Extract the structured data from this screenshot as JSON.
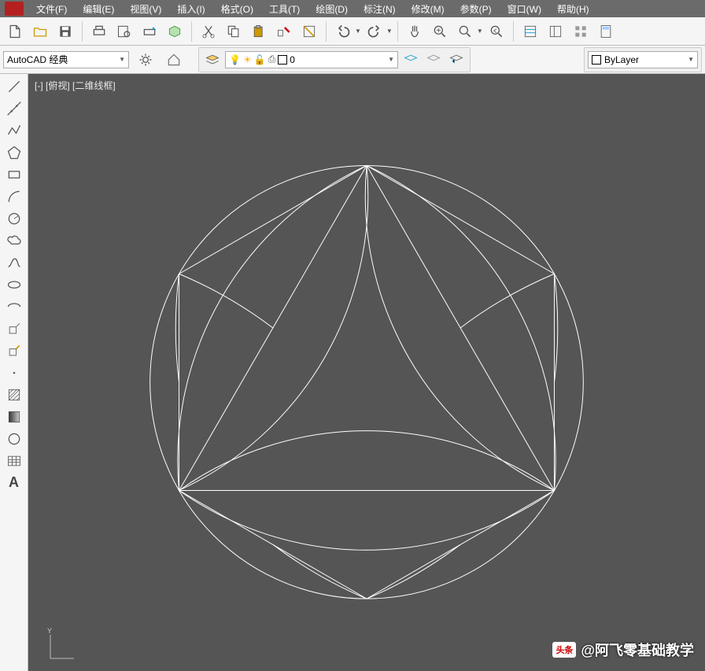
{
  "menu": {
    "items": [
      "文件(F)",
      "编辑(E)",
      "视图(V)",
      "插入(I)",
      "格式(O)",
      "工具(T)",
      "绘图(D)",
      "标注(N)",
      "修改(M)",
      "参数(P)",
      "窗口(W)",
      "帮助(H)"
    ]
  },
  "workspace": {
    "label": "AutoCAD 经典"
  },
  "layer": {
    "current": "0"
  },
  "props": {
    "bylayer": "ByLayer"
  },
  "viewport": {
    "label": "[-] [俯视] [二维线框]"
  },
  "watermark": {
    "badge": "头条",
    "text": "@阿飞零基础教学"
  }
}
